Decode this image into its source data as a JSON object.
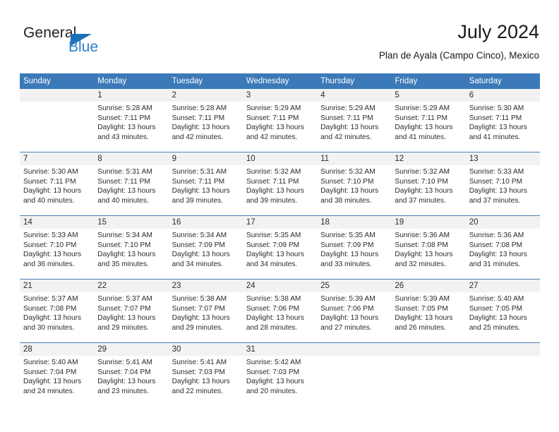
{
  "logo": {
    "word_one": "General",
    "word_two": "Blue",
    "triangle_color": "#1c6fba",
    "blue_color": "#2a7fc9"
  },
  "header": {
    "title": "July 2024",
    "subtitle": "Plan de Ayala (Campo Cinco), Mexico"
  },
  "theme": {
    "header_blue": "#3b79b8",
    "row_divider": "#4a7fb5",
    "number_band": "#f2f2f2"
  },
  "calendar": {
    "weekday_headers": [
      "Sunday",
      "Monday",
      "Tuesday",
      "Wednesday",
      "Thursday",
      "Friday",
      "Saturday"
    ],
    "weeks": [
      [
        {
          "day": "",
          "sunrise": "",
          "sunset": "",
          "daylight": ""
        },
        {
          "day": "1",
          "sunrise": "Sunrise: 5:28 AM",
          "sunset": "Sunset: 7:11 PM",
          "daylight": "Daylight: 13 hours and 43 minutes."
        },
        {
          "day": "2",
          "sunrise": "Sunrise: 5:28 AM",
          "sunset": "Sunset: 7:11 PM",
          "daylight": "Daylight: 13 hours and 42 minutes."
        },
        {
          "day": "3",
          "sunrise": "Sunrise: 5:29 AM",
          "sunset": "Sunset: 7:11 PM",
          "daylight": "Daylight: 13 hours and 42 minutes."
        },
        {
          "day": "4",
          "sunrise": "Sunrise: 5:29 AM",
          "sunset": "Sunset: 7:11 PM",
          "daylight": "Daylight: 13 hours and 42 minutes."
        },
        {
          "day": "5",
          "sunrise": "Sunrise: 5:29 AM",
          "sunset": "Sunset: 7:11 PM",
          "daylight": "Daylight: 13 hours and 41 minutes."
        },
        {
          "day": "6",
          "sunrise": "Sunrise: 5:30 AM",
          "sunset": "Sunset: 7:11 PM",
          "daylight": "Daylight: 13 hours and 41 minutes."
        }
      ],
      [
        {
          "day": "7",
          "sunrise": "Sunrise: 5:30 AM",
          "sunset": "Sunset: 7:11 PM",
          "daylight": "Daylight: 13 hours and 40 minutes."
        },
        {
          "day": "8",
          "sunrise": "Sunrise: 5:31 AM",
          "sunset": "Sunset: 7:11 PM",
          "daylight": "Daylight: 13 hours and 40 minutes."
        },
        {
          "day": "9",
          "sunrise": "Sunrise: 5:31 AM",
          "sunset": "Sunset: 7:11 PM",
          "daylight": "Daylight: 13 hours and 39 minutes."
        },
        {
          "day": "10",
          "sunrise": "Sunrise: 5:32 AM",
          "sunset": "Sunset: 7:11 PM",
          "daylight": "Daylight: 13 hours and 39 minutes."
        },
        {
          "day": "11",
          "sunrise": "Sunrise: 5:32 AM",
          "sunset": "Sunset: 7:10 PM",
          "daylight": "Daylight: 13 hours and 38 minutes."
        },
        {
          "day": "12",
          "sunrise": "Sunrise: 5:32 AM",
          "sunset": "Sunset: 7:10 PM",
          "daylight": "Daylight: 13 hours and 37 minutes."
        },
        {
          "day": "13",
          "sunrise": "Sunrise: 5:33 AM",
          "sunset": "Sunset: 7:10 PM",
          "daylight": "Daylight: 13 hours and 37 minutes."
        }
      ],
      [
        {
          "day": "14",
          "sunrise": "Sunrise: 5:33 AM",
          "sunset": "Sunset: 7:10 PM",
          "daylight": "Daylight: 13 hours and 36 minutes."
        },
        {
          "day": "15",
          "sunrise": "Sunrise: 5:34 AM",
          "sunset": "Sunset: 7:10 PM",
          "daylight": "Daylight: 13 hours and 35 minutes."
        },
        {
          "day": "16",
          "sunrise": "Sunrise: 5:34 AM",
          "sunset": "Sunset: 7:09 PM",
          "daylight": "Daylight: 13 hours and 34 minutes."
        },
        {
          "day": "17",
          "sunrise": "Sunrise: 5:35 AM",
          "sunset": "Sunset: 7:09 PM",
          "daylight": "Daylight: 13 hours and 34 minutes."
        },
        {
          "day": "18",
          "sunrise": "Sunrise: 5:35 AM",
          "sunset": "Sunset: 7:09 PM",
          "daylight": "Daylight: 13 hours and 33 minutes."
        },
        {
          "day": "19",
          "sunrise": "Sunrise: 5:36 AM",
          "sunset": "Sunset: 7:08 PM",
          "daylight": "Daylight: 13 hours and 32 minutes."
        },
        {
          "day": "20",
          "sunrise": "Sunrise: 5:36 AM",
          "sunset": "Sunset: 7:08 PM",
          "daylight": "Daylight: 13 hours and 31 minutes."
        }
      ],
      [
        {
          "day": "21",
          "sunrise": "Sunrise: 5:37 AM",
          "sunset": "Sunset: 7:08 PM",
          "daylight": "Daylight: 13 hours and 30 minutes."
        },
        {
          "day": "22",
          "sunrise": "Sunrise: 5:37 AM",
          "sunset": "Sunset: 7:07 PM",
          "daylight": "Daylight: 13 hours and 29 minutes."
        },
        {
          "day": "23",
          "sunrise": "Sunrise: 5:38 AM",
          "sunset": "Sunset: 7:07 PM",
          "daylight": "Daylight: 13 hours and 29 minutes."
        },
        {
          "day": "24",
          "sunrise": "Sunrise: 5:38 AM",
          "sunset": "Sunset: 7:06 PM",
          "daylight": "Daylight: 13 hours and 28 minutes."
        },
        {
          "day": "25",
          "sunrise": "Sunrise: 5:39 AM",
          "sunset": "Sunset: 7:06 PM",
          "daylight": "Daylight: 13 hours and 27 minutes."
        },
        {
          "day": "26",
          "sunrise": "Sunrise: 5:39 AM",
          "sunset": "Sunset: 7:05 PM",
          "daylight": "Daylight: 13 hours and 26 minutes."
        },
        {
          "day": "27",
          "sunrise": "Sunrise: 5:40 AM",
          "sunset": "Sunset: 7:05 PM",
          "daylight": "Daylight: 13 hours and 25 minutes."
        }
      ],
      [
        {
          "day": "28",
          "sunrise": "Sunrise: 5:40 AM",
          "sunset": "Sunset: 7:04 PM",
          "daylight": "Daylight: 13 hours and 24 minutes."
        },
        {
          "day": "29",
          "sunrise": "Sunrise: 5:41 AM",
          "sunset": "Sunset: 7:04 PM",
          "daylight": "Daylight: 13 hours and 23 minutes."
        },
        {
          "day": "30",
          "sunrise": "Sunrise: 5:41 AM",
          "sunset": "Sunset: 7:03 PM",
          "daylight": "Daylight: 13 hours and 22 minutes."
        },
        {
          "day": "31",
          "sunrise": "Sunrise: 5:42 AM",
          "sunset": "Sunset: 7:03 PM",
          "daylight": "Daylight: 13 hours and 20 minutes."
        },
        {
          "day": "",
          "sunrise": "",
          "sunset": "",
          "daylight": ""
        },
        {
          "day": "",
          "sunrise": "",
          "sunset": "",
          "daylight": ""
        },
        {
          "day": "",
          "sunrise": "",
          "sunset": "",
          "daylight": ""
        }
      ]
    ]
  }
}
